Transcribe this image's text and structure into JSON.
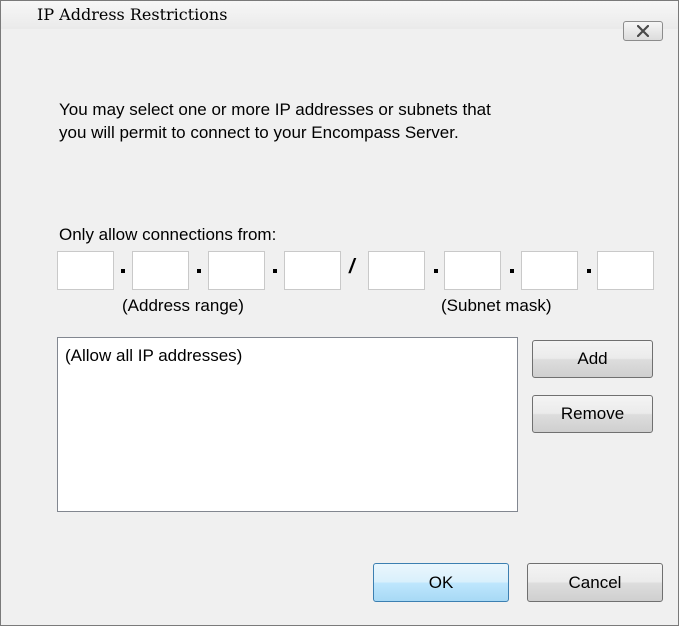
{
  "window": {
    "title": "IP Address Restrictions",
    "close_icon": "close-x-icon"
  },
  "intro": {
    "text": "You may select one or more IP addresses or subnets that\nyou will permit to connect to your Encompass Server."
  },
  "ip_input": {
    "label": "Only allow connections from:",
    "address_octets": [
      "",
      "",
      "",
      ""
    ],
    "separator": "/",
    "subnet_octets": [
      "",
      "",
      "",
      ""
    ],
    "address_hint": "(Address range)",
    "subnet_hint": "(Subnet mask)"
  },
  "list": {
    "items": [
      "(Allow all IP addresses)"
    ]
  },
  "buttons": {
    "add": "Add",
    "remove": "Remove",
    "ok": "OK",
    "cancel": "Cancel"
  },
  "colors": {
    "dialog_bg": "#f0f0f0",
    "default_button_border": "#3c7fb1"
  }
}
